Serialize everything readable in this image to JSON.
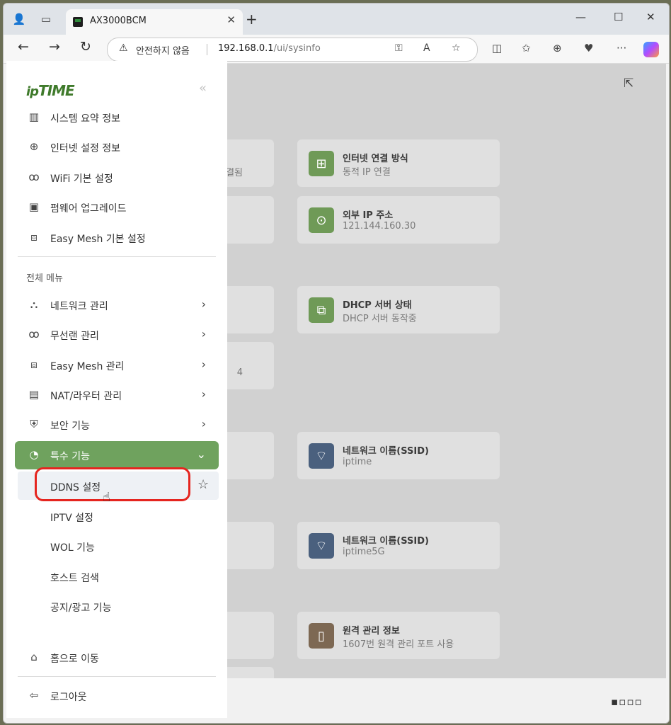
{
  "browser": {
    "tab_title": "AX3000BCM",
    "security_warning": "안전하지 않음",
    "url_host": "192.168.0.1",
    "url_path": "/ui/sysinfo"
  },
  "sidebar": {
    "logo_ip": "ip",
    "logo_time": "TIME",
    "collapse_glyph": "«",
    "quick_items": [
      {
        "label": "시스템 요약 정보",
        "icon": "bar-chart-icon"
      },
      {
        "label": "인터넷 설정 정보",
        "icon": "internet-globe-icon"
      },
      {
        "label": "WiFi 기본 설정",
        "icon": "wifi-antenna-icon"
      },
      {
        "label": "펌웨어 업그레이드",
        "icon": "firmware-chip-icon"
      },
      {
        "label": "Easy Mesh 기본 설정",
        "icon": "mesh-icon"
      }
    ],
    "section_title": "전체 메뉴",
    "menu_items": [
      {
        "label": "네트워크 관리",
        "icon": "network-icon"
      },
      {
        "label": "무선랜 관리",
        "icon": "wifi-antenna-icon"
      },
      {
        "label": "Easy Mesh 관리",
        "icon": "mesh-icon"
      },
      {
        "label": "NAT/라우터 관리",
        "icon": "router-icon"
      },
      {
        "label": "보안 기능",
        "icon": "shield-icon"
      }
    ],
    "active_item": {
      "label": "특수 기능",
      "icon": "gauge-icon"
    },
    "sub_items": [
      "DDNS 설정",
      "IPTV 설정",
      "WOL 기능",
      "호스트 검색",
      "공지/광고 기능"
    ],
    "footer_items": [
      {
        "label": "홈으로 이동",
        "icon": "home-icon"
      },
      {
        "label": "로그아웃",
        "icon": "logout-icon"
      }
    ]
  },
  "main": {
    "left_card_text_1": "결됨",
    "left_card_text_2": "4",
    "cards": [
      {
        "title": "인터넷 연결 방식",
        "sub": "동적 IP 연결",
        "icon": "internet-connection-icon",
        "color": "#6f9a57"
      },
      {
        "title": "외부 IP 주소",
        "sub": "121.144.160.30",
        "icon": "location-ip-icon",
        "color": "#6f9a57"
      },
      {
        "title": "DHCP 서버 상태",
        "sub": "DHCP 서버 동작중",
        "icon": "dhcp-icon",
        "color": "#6f9a57"
      },
      {
        "title": "네트워크 이름(SSID)",
        "sub": "iptime",
        "icon": "wifi-icon",
        "color": "#4a607e"
      },
      {
        "title": "네트워크 이름(SSID)",
        "sub": "iptime5G",
        "icon": "wifi-5g-icon",
        "color": "#4a607e"
      },
      {
        "title": "원격 관리 정보",
        "sub": "1607번 원격 관리 포트 사용",
        "icon": "remote-control-icon",
        "color": "#7d6853"
      }
    ]
  }
}
